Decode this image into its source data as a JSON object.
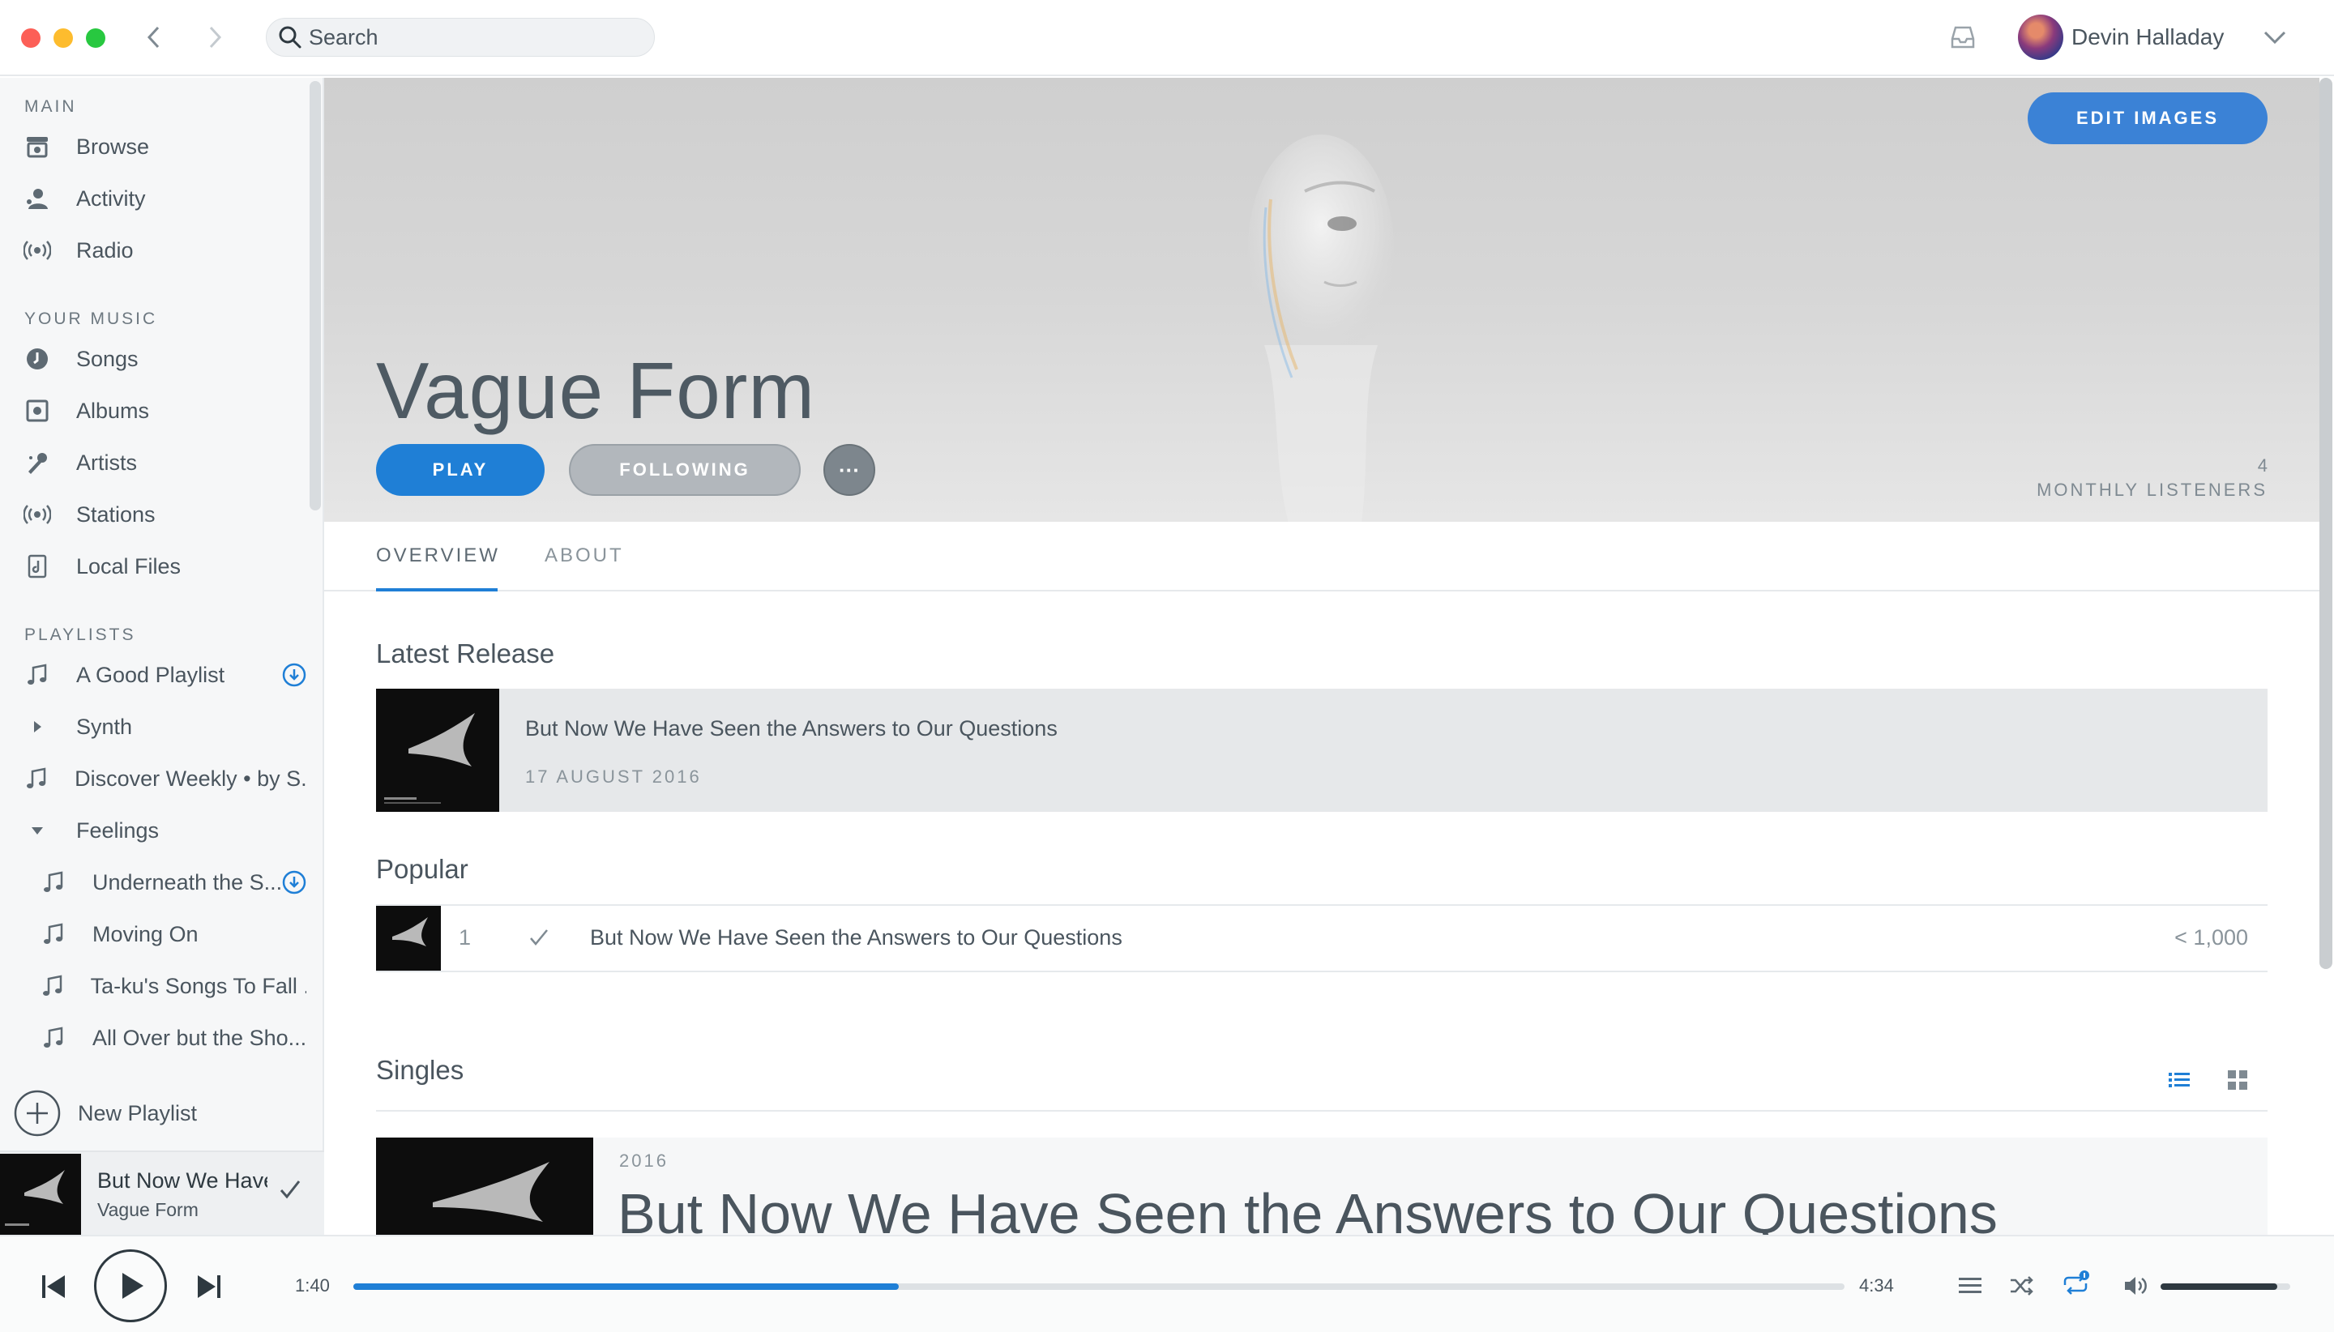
{
  "search": {
    "placeholder": "Search"
  },
  "user": {
    "name": "Devin Halladay"
  },
  "sidebar": {
    "main_header": "MAIN",
    "main_items": [
      {
        "label": "Browse",
        "icon": "browse-icon"
      },
      {
        "label": "Activity",
        "icon": "activity-icon"
      },
      {
        "label": "Radio",
        "icon": "radio-icon"
      }
    ],
    "music_header": "YOUR MUSIC",
    "music_items": [
      {
        "label": "Songs",
        "icon": "songs-icon"
      },
      {
        "label": "Albums",
        "icon": "albums-icon"
      },
      {
        "label": "Artists",
        "icon": "artists-icon"
      },
      {
        "label": "Stations",
        "icon": "stations-icon"
      },
      {
        "label": "Local Files",
        "icon": "local-files-icon"
      }
    ],
    "playlists_header": "PLAYLISTS",
    "playlists": [
      {
        "label": "A Good Playlist",
        "icon": "music-note-icon",
        "downloaded": true
      },
      {
        "label": "Synth",
        "icon": "folder-collapsed-icon"
      },
      {
        "label": "Discover Weekly • by S...",
        "icon": "music-note-icon"
      },
      {
        "label": "Feelings",
        "icon": "folder-expanded-icon"
      }
    ],
    "folder_playlists": [
      {
        "label": "Underneath the S...",
        "icon": "music-note-icon",
        "downloaded": true
      },
      {
        "label": "Moving On",
        "icon": "music-note-icon"
      },
      {
        "label": "Ta-ku's Songs To Fall ...",
        "icon": "music-note-icon"
      },
      {
        "label": "All Over but the Sho...",
        "icon": "music-note-icon"
      }
    ],
    "new_playlist": "New Playlist"
  },
  "now_playing": {
    "title": "But Now We Have Seen the Answers to Our Questions",
    "artist": "Vague Form"
  },
  "artist": {
    "name": "Vague Form",
    "edit_images": "EDIT IMAGES",
    "play": "PLAY",
    "following": "FOLLOWING",
    "more": "···",
    "monthly_listeners_count": "4",
    "monthly_listeners_label": "MONTHLY LISTENERS"
  },
  "tabs": [
    "OVERVIEW",
    "ABOUT"
  ],
  "latest_release": {
    "heading": "Latest Release",
    "title": "But Now We Have Seen the Answers to Our Questions",
    "date": "17 AUGUST 2016"
  },
  "popular": {
    "heading": "Popular",
    "tracks": [
      {
        "num": "1",
        "title": "But Now We Have Seen the Answers to Our Questions",
        "plays": "< 1,000"
      }
    ]
  },
  "singles": {
    "heading": "Singles",
    "items": [
      {
        "year": "2016",
        "title": "But Now We Have Seen the Answers to Our Questions"
      }
    ]
  },
  "player": {
    "elapsed": "1:40",
    "total": "4:34",
    "progress": 0.366,
    "volume": 0.9
  },
  "colors": {
    "accent": "#1f7fd6",
    "edit_images_bg": "#3b82d6",
    "following_bg": "#b2b7bc"
  }
}
